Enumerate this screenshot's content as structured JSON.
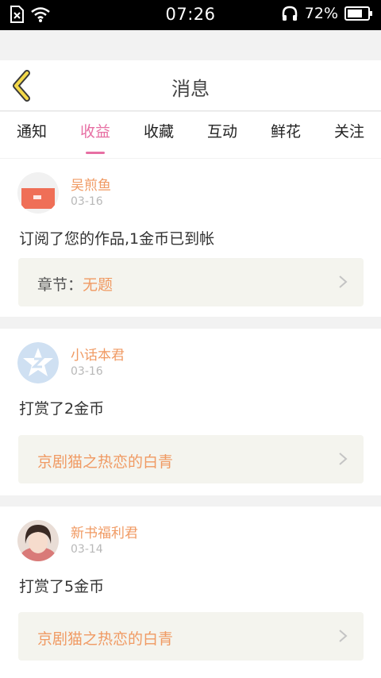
{
  "status_bar": {
    "time": "07:26",
    "battery": "72%",
    "icons": [
      "no-sim-icon",
      "wifi-icon",
      "headphone-icon",
      "battery-icon"
    ]
  },
  "header": {
    "title": "消息",
    "back_icon": "chevron-left-icon"
  },
  "tabs": [
    {
      "label": "通知"
    },
    {
      "label": "收益",
      "active": true
    },
    {
      "label": "收藏"
    },
    {
      "label": "互动"
    },
    {
      "label": "鲜花"
    },
    {
      "label": "关注"
    }
  ],
  "messages": [
    {
      "sender": "吴煎鱼",
      "date": "03-16",
      "text": "订阅了您的作品,1金币已到帐",
      "link_prefix": "章节：",
      "link_label": "无题"
    },
    {
      "sender": "小话本君",
      "date": "03-16",
      "text": "打赏了2金币",
      "link_prefix": "",
      "link_label": "京剧猫之热恋的白青"
    },
    {
      "sender": "新书福利君",
      "date": "03-14",
      "text": "打赏了5金币",
      "link_prefix": "",
      "link_label": "京剧猫之热恋的白青"
    }
  ],
  "colors": {
    "accent": "#e76fa3",
    "sender": "#f09a63",
    "link_bg": "#f4f4ee"
  }
}
